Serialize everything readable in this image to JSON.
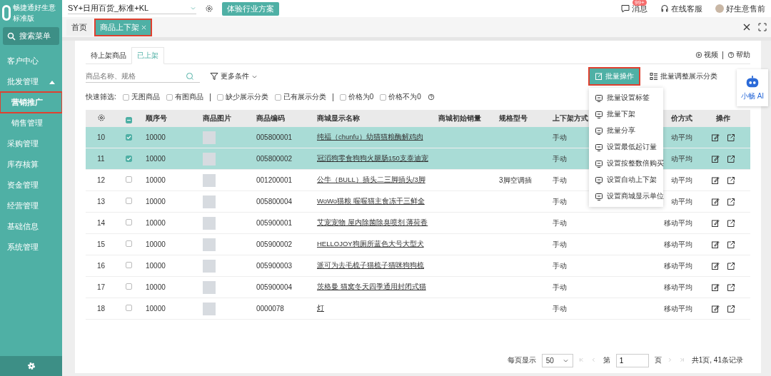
{
  "sidebar": {
    "logo_text": "畅捷通好生意",
    "edition": "标准版",
    "search": "搜索菜单",
    "items": [
      {
        "label": "客户中心",
        "selected": false,
        "highlighted": false
      },
      {
        "label": "批发管理",
        "selected": false,
        "highlighted": false,
        "expanded": true,
        "children": [
          {
            "label": "营销推广",
            "selected": true,
            "highlighted": true
          },
          {
            "label": "销售管理",
            "selected": false,
            "highlighted": false
          }
        ]
      },
      {
        "label": "采购管理",
        "selected": false,
        "highlighted": false
      },
      {
        "label": "库存核算",
        "selected": false,
        "highlighted": false
      },
      {
        "label": "资金管理",
        "selected": false,
        "highlighted": false
      },
      {
        "label": "经营管理",
        "selected": false,
        "highlighted": false
      },
      {
        "label": "基础信息",
        "selected": false,
        "highlighted": false
      },
      {
        "label": "系统管理",
        "selected": false,
        "highlighted": false
      }
    ]
  },
  "top_bar": {
    "company": "SY+日用百货_标准+KL",
    "industry_button": "体验行业方案",
    "messages": "消息",
    "messages_badge": "99+",
    "support": "在线客服",
    "user": "好生意售前"
  },
  "page_tabs": [
    {
      "label": "首页",
      "selected": false,
      "closable": false,
      "highlighted": false
    },
    {
      "label": "商品上下架",
      "selected": true,
      "closable": true,
      "highlighted": true
    }
  ],
  "sub_tabs": [
    {
      "label": "待上架商品",
      "selected": false
    },
    {
      "label": "已上架",
      "selected": true
    }
  ],
  "help_links": [
    "视频",
    "帮助"
  ],
  "search": {
    "placeholder": "商品名称、规格"
  },
  "more_filters": "更多条件",
  "batch_button": {
    "label": "批量操作",
    "highlighted": true
  },
  "adjust_category": "批量调整展示分类",
  "ai_assistant": "小畅 AI",
  "batch_menu": [
    "批量设置标签",
    "批量下架",
    "批量分享",
    "设置最低起订量",
    "设置按整数倍购买",
    "设置自动上下架",
    "设置商城显示单位"
  ],
  "quick_filter": {
    "label": "快速筛选:",
    "groups": [
      [
        {
          "label": "无图商品",
          "checked": false
        },
        {
          "label": "有图商品",
          "checked": false
        }
      ],
      [
        {
          "label": "缺少展示分类",
          "checked": false
        },
        {
          "label": "已有展示分类",
          "checked": false
        }
      ],
      [
        {
          "label": "价格为0",
          "checked": false
        },
        {
          "label": "价格不为0",
          "checked": false
        }
      ]
    ]
  },
  "table": {
    "select_all_indeterminate": true,
    "columns": [
      "顺序号",
      "商品图片",
      "商品编码",
      "商城显示名称",
      "商城初始销量",
      "规格型号",
      "上下架方式",
      "价方式",
      "操作"
    ],
    "rows": [
      {
        "index": "10",
        "selected": true,
        "seq": "10000",
        "code": "005800001",
        "name": "纯福（chunfu）幼猫猫粮酶解鸡肉",
        "spec": "",
        "shelf_mode": "手动",
        "pricing": "动平均"
      },
      {
        "index": "11",
        "selected": true,
        "seq": "10000",
        "code": "005800002",
        "name": "冠滔狗零食狗狗火腿肠150支泰迪宠",
        "spec": "",
        "shelf_mode": "手动",
        "pricing": "动平均"
      },
      {
        "index": "12",
        "selected": false,
        "seq": "10000",
        "code": "001200001",
        "name": "公牛（BULL）插头二三脚插头/3脚",
        "spec": "3脚空调插",
        "shelf_mode": "手动",
        "pricing": "动平均"
      },
      {
        "index": "13",
        "selected": false,
        "seq": "10000",
        "code": "005800004",
        "name": "WoWo猫粮 喔喔猫主食冻干三鲜全",
        "spec": "",
        "shelf_mode": "手动",
        "pricing": "动平均"
      },
      {
        "index": "14",
        "selected": false,
        "seq": "10000",
        "code": "005900001",
        "name": "艾宠宠物 屋内除菌除臭喷剂 薄荷香",
        "spec": "",
        "shelf_mode": "手动",
        "pricing": "移动平均"
      },
      {
        "index": "15",
        "selected": false,
        "seq": "10000",
        "code": "005900002",
        "name": "HELLOJOY狗厕所蓝色大号大型犬",
        "spec": "",
        "shelf_mode": "手动",
        "pricing": "移动平均"
      },
      {
        "index": "16",
        "selected": false,
        "seq": "10000",
        "code": "005900003",
        "name": "派可为去毛梳子猫梳子猫咪狗狗梳",
        "spec": "",
        "shelf_mode": "手动",
        "pricing": "移动平均"
      },
      {
        "index": "17",
        "selected": false,
        "seq": "10000",
        "code": "005900004",
        "name": "茨格曼 猫窝冬天四季通用封闭式猫",
        "spec": "",
        "shelf_mode": "手动",
        "pricing": "移动平均"
      },
      {
        "index": "18",
        "selected": false,
        "seq": "10000",
        "code": "0000078",
        "name": "灯",
        "spec": "",
        "shelf_mode": "手动",
        "pricing": "移动平均"
      }
    ]
  },
  "pagination": {
    "per_page_label": "每页显示",
    "per_page": "50",
    "page_prefix": "第",
    "page": "1",
    "page_suffix": "页",
    "summary": "共1页, 41条记录"
  }
}
